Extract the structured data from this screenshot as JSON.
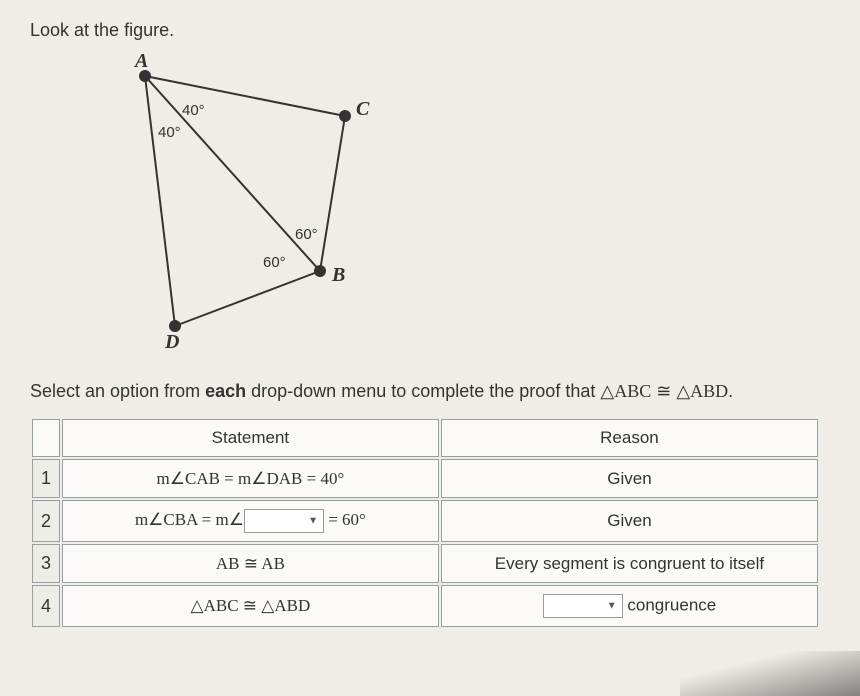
{
  "prompt": "Look at the figure.",
  "figure": {
    "vertices": {
      "A": "A",
      "B": "B",
      "C": "C",
      "D": "D"
    },
    "angles": {
      "a1": "40°",
      "a2": "40°",
      "b1": "60°",
      "b2": "60°"
    }
  },
  "instruction_parts": {
    "pre": "Select an option from ",
    "bold": "each",
    "mid": " drop-down menu to complete the proof that ",
    "tri1": "△ABC",
    "cong": " ≅ ",
    "tri2": "△ABD",
    "end": "."
  },
  "table": {
    "headers": {
      "statement": "Statement",
      "reason": "Reason"
    },
    "rows": [
      {
        "num": "1",
        "statement": "m∠CAB = m∠DAB = 40°",
        "reason": "Given"
      },
      {
        "num": "2",
        "statement_pre": "m∠CBA = m∠",
        "statement_post": " = 60°",
        "reason": "Given"
      },
      {
        "num": "3",
        "statement": "AB ≅ AB",
        "reason": "Every segment is congruent to itself"
      },
      {
        "num": "4",
        "statement": "△ABC ≅ △ABD",
        "reason_post": " congruence"
      }
    ]
  }
}
